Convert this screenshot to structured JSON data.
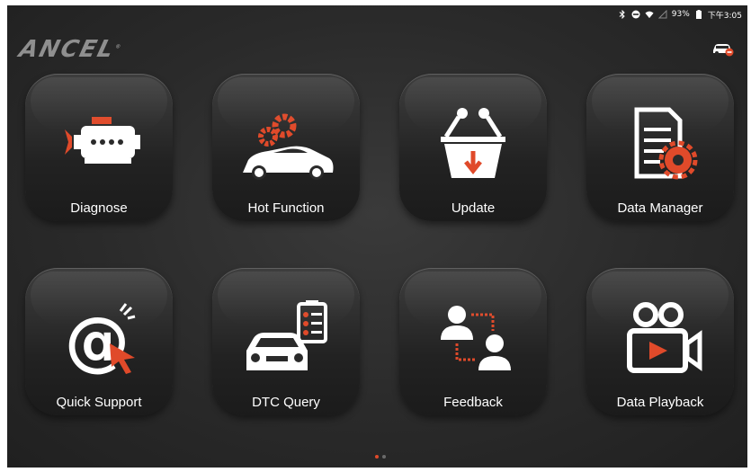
{
  "status_bar": {
    "icons": [
      "bluetooth-icon",
      "dnd-icon",
      "wifi-icon",
      "signal-icon"
    ],
    "battery": "93%",
    "time": "下午3:05"
  },
  "brand": {
    "logo_text": "ANCEL",
    "trademark": "®"
  },
  "colors": {
    "accent": "#e04a2a",
    "background": "#2a2a2a",
    "tile": "#262626",
    "text": "#ffffff"
  },
  "apps": [
    {
      "label": "Diagnose",
      "icon": "engine-icon"
    },
    {
      "label": "Hot Function",
      "icon": "car-gears-icon"
    },
    {
      "label": "Update",
      "icon": "basket-download-icon"
    },
    {
      "label": "Data Manager",
      "icon": "document-gear-icon"
    },
    {
      "label": "Quick Support",
      "icon": "at-cursor-icon"
    },
    {
      "label": "DTC Query",
      "icon": "car-checklist-icon"
    },
    {
      "label": "Feedback",
      "icon": "users-exchange-icon"
    },
    {
      "label": "Data Playback",
      "icon": "video-camera-icon"
    }
  ],
  "pager": {
    "pages": 2,
    "current": 1
  }
}
